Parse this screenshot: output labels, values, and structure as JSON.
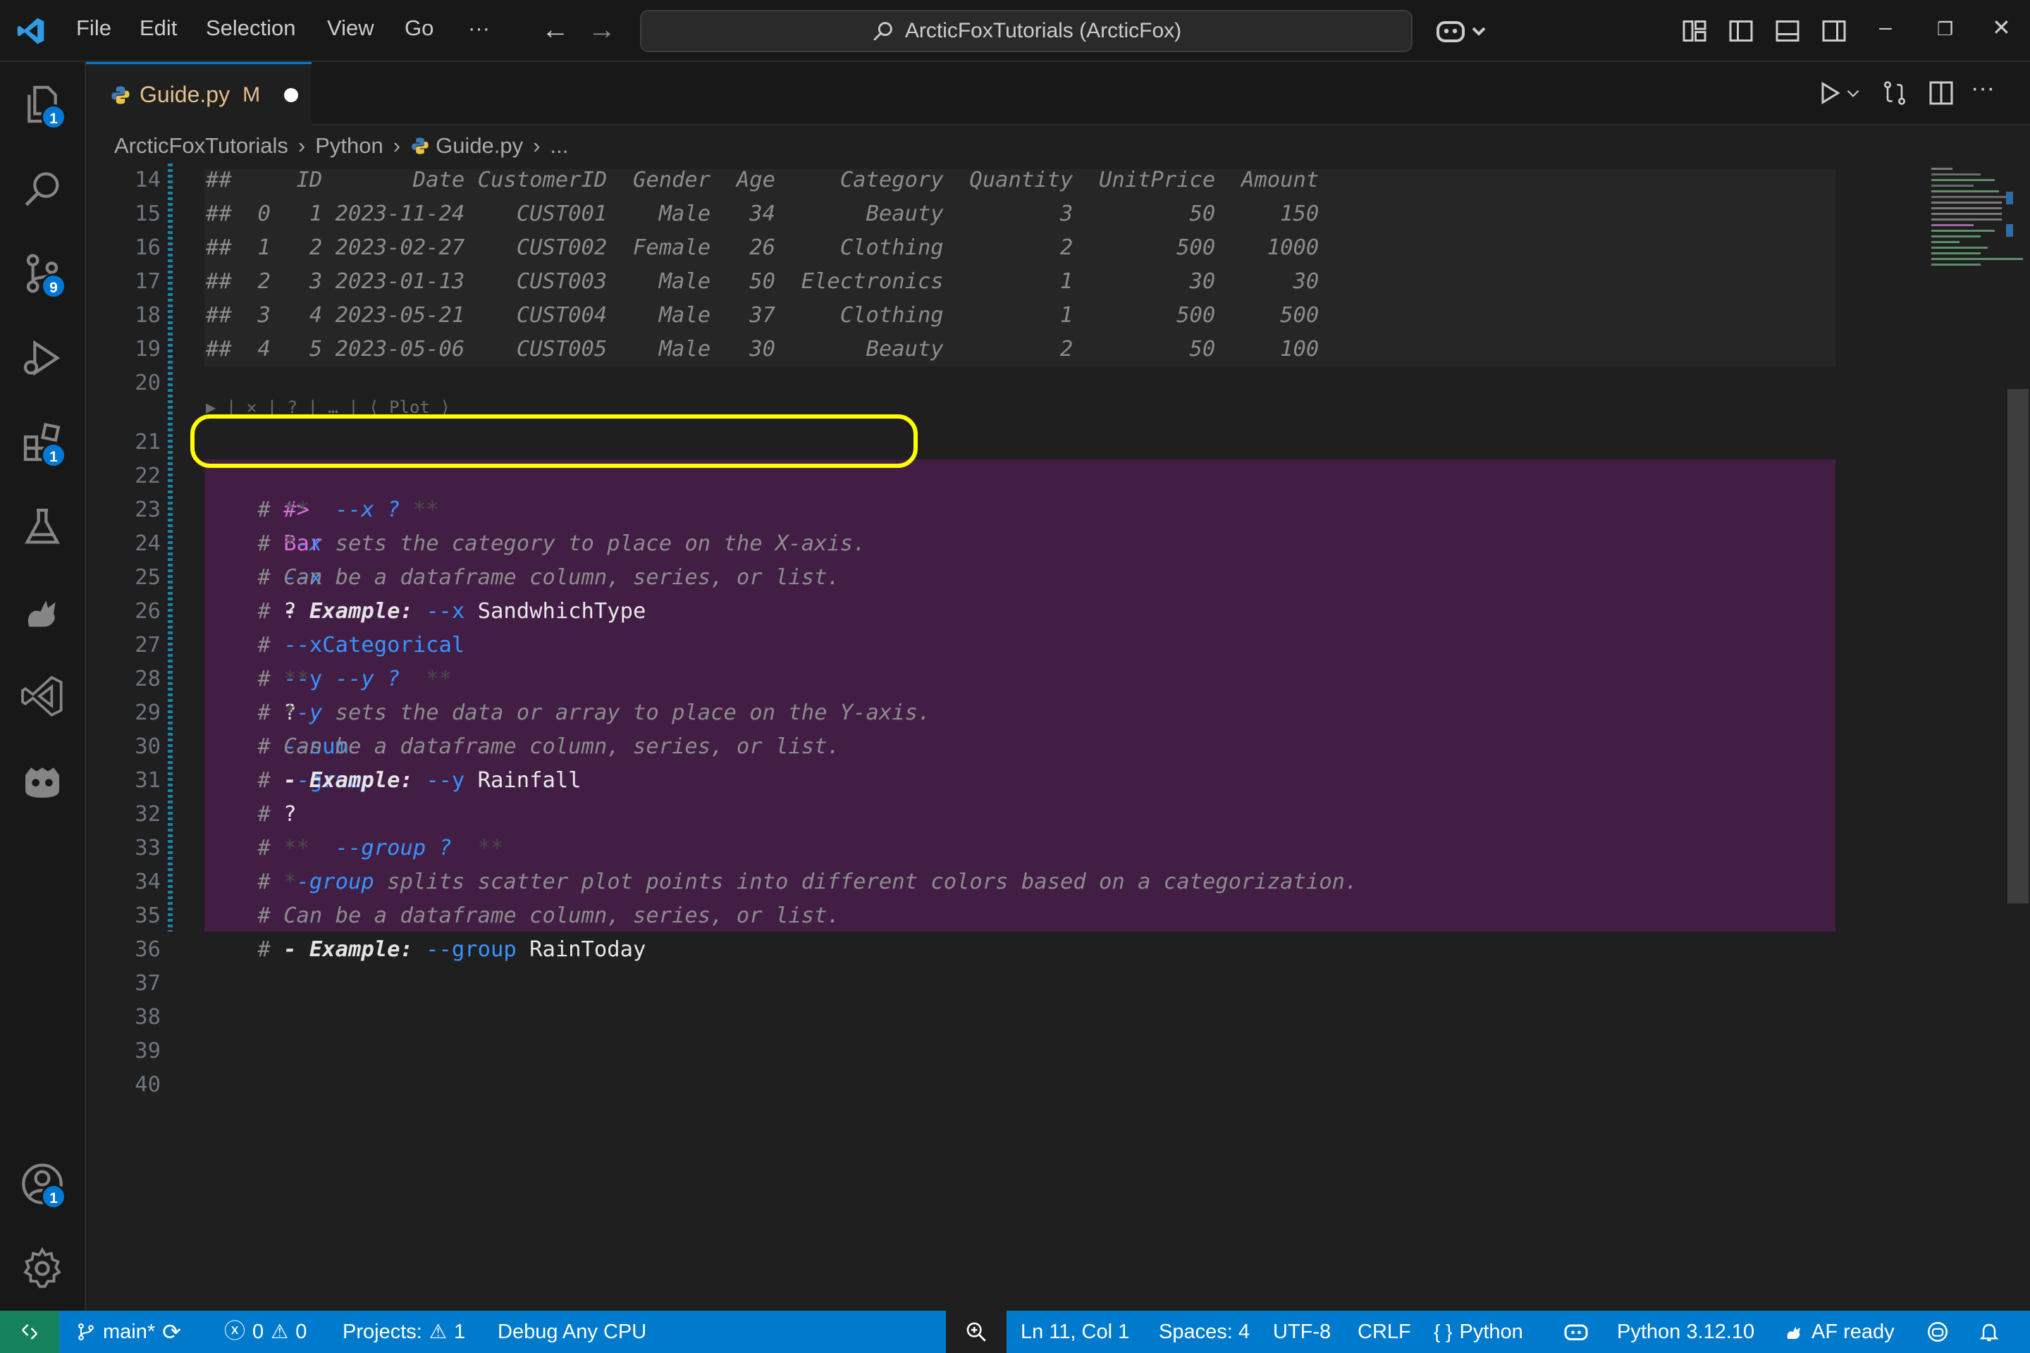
{
  "titlebar": {
    "menu": [
      "File",
      "Edit",
      "Selection",
      "View",
      "Go",
      "···"
    ],
    "search_text": "ArcticFoxTutorials (ArcticFox)"
  },
  "activity": {
    "explorer_badge": "1",
    "source_control_badge": "9",
    "extensions_badge": "1",
    "accounts_badge": "1"
  },
  "tab": {
    "label": "Guide.py",
    "modified": "M"
  },
  "breadcrumb": [
    "ArcticFoxTutorials",
    "Python",
    "Guide.py",
    "..."
  ],
  "editor": {
    "codelens": "▶ | ✕ | ? | … | ⟨ Plot ⟩",
    "line_numbers": [
      "14",
      "15",
      "16",
      "17",
      "18",
      "19",
      "20",
      "21",
      "22",
      "23",
      "24",
      "25",
      "26",
      "27",
      "28",
      "29",
      "30",
      "31",
      "32",
      "33",
      "34",
      "35",
      "36",
      "37",
      "38",
      "39",
      "40"
    ],
    "output_rows": [
      "##     ID       Date CustomerID  Gender  Age     Category  Quantity  UnitPrice  Amount",
      "##  0   1 2023-11-24    CUST001    Male   34       Beauty         3         50     150",
      "##  1   2 2023-02-27    CUST002  Female   26     Clothing         2        500    1000",
      "##  2   3 2023-01-13    CUST003    Male   50  Electronics         1         30      30",
      "##  3   4 2023-05-21    CUST004    Male   37     Clothing         1        500     500",
      "##  4   5 2023-05-06    CUST005    Male   30       Beauty         2         50     100"
    ],
    "cmd": {
      "prefix": "#>",
      "name": "Bar",
      "x_flag": "--x",
      "q1": "?",
      "xcat": "--xCategorical",
      "y_flag": "--y",
      "q2": "?",
      "sum": "--sum",
      "group": "--group",
      "q3": "?"
    },
    "doc": {
      "hash": "#",
      "l22_a": " **  ",
      "l22_b": "--x ?",
      "l22_c": " **",
      "l23_a": " *",
      "l23_b": "-x",
      "l23_c": " sets the category to place on the X-axis.",
      "l24": " Can be a dataframe column, series, or list.",
      "l25_a": " - Example:",
      "l25_b": " --x",
      "l25_c": " SandwhichType",
      "l27_a": " **  ",
      "l27_b": "--y ?",
      "l27_c": "  **",
      "l28_a": " *",
      "l28_b": "-y",
      "l28_c": " sets the data or array to place on the Y-axis.",
      "l29": " Can be a dataframe column, series, or list.",
      "l30_a": " - Example:",
      "l30_b": " --y",
      "l30_c": " Rainfall",
      "l32_a": " **  ",
      "l32_b": "--group ?",
      "l32_c": "  **",
      "l33_a": " *",
      "l33_b": "-group",
      "l33_c": " splits scatter plot points into different colors based on a categorization.",
      "l34": " Can be a dataframe column, series, or list.",
      "l35_a": " - Example:",
      "l35_b": " --group",
      "l35_c": " RainToday"
    }
  },
  "statusbar": {
    "branch": "main*",
    "errors": "0",
    "warnings": "0",
    "projects": "Projects:",
    "projects_count": "1",
    "debug": "Debug Any CPU",
    "position": "Ln 11, Col 1",
    "spaces": "Spaces: 4",
    "encoding": "UTF-8",
    "eol": "CRLF",
    "language": "Python",
    "interpreter": "Python 3.12.10",
    "af": "AF ready"
  },
  "colors": {
    "accent": "#007acc",
    "remote": "#16825d",
    "highlight": "#ffff00",
    "cell_bg": "#421e45"
  }
}
